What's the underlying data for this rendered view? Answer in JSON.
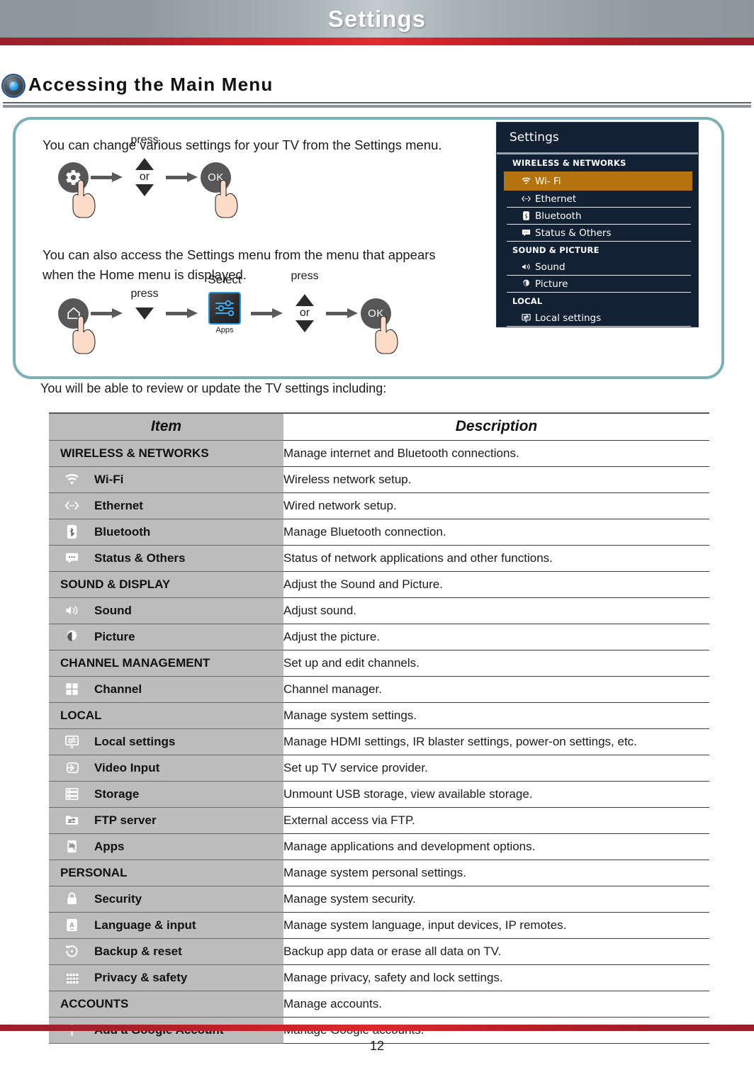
{
  "banner": {
    "title": "Settings"
  },
  "section": {
    "heading": "Accessing the Main Menu",
    "icon": "blue-orb-icon"
  },
  "instructions": {
    "line1": "You can change various settings for your TV from the Settings menu.",
    "line2": "You can also access the Settings menu from the menu that appears when the Home menu is displayed.",
    "flow1": {
      "start_button": "gear-icon",
      "press_label": "press",
      "or_label": "or",
      "ok_label": "OK"
    },
    "flow2": {
      "start_button": "home-icon",
      "press_label_1": "press",
      "select_label": "Select",
      "apps_label": "Apps",
      "press_label_2": "press",
      "or_label": "or",
      "ok_label": "OK"
    }
  },
  "tv_panel": {
    "title": "Settings",
    "highlight_color": "#b5730f",
    "background_color": "#122034",
    "groups": [
      {
        "label": "WIRELESS & NETWORKS",
        "items": [
          {
            "label": "Wi- Fi",
            "icon": "wifi-icon",
            "selected": true
          },
          {
            "label": "Ethernet",
            "icon": "ethernet-icon",
            "selected": false
          },
          {
            "label": "Bluetooth",
            "icon": "bluetooth-icon",
            "selected": false
          },
          {
            "label": "Status & Others",
            "icon": "status-icon",
            "selected": false
          }
        ]
      },
      {
        "label": "SOUND & PICTURE",
        "items": [
          {
            "label": "Sound",
            "icon": "speaker-icon",
            "selected": false
          },
          {
            "label": "Picture",
            "icon": "brightness-icon",
            "selected": false
          }
        ]
      },
      {
        "label": "LOCAL",
        "items": [
          {
            "label": "Local settings",
            "icon": "monitor-settings-icon",
            "selected": false
          }
        ]
      }
    ]
  },
  "sub_caption": "You will be able to review or update the TV settings including:",
  "table": {
    "headers": {
      "item": "Item",
      "description": "Description"
    },
    "rows": [
      {
        "type": "category",
        "item": "WIRELESS & NETWORKS",
        "description": "Manage internet and Bluetooth connections."
      },
      {
        "type": "sub",
        "icon": "wifi-icon",
        "item": "Wi-Fi",
        "description": "Wireless network setup."
      },
      {
        "type": "sub",
        "icon": "ethernet-icon",
        "item": "Ethernet",
        "description": "Wired network setup."
      },
      {
        "type": "sub",
        "icon": "bluetooth-icon",
        "item": "Bluetooth",
        "description": "Manage Bluetooth connection."
      },
      {
        "type": "sub",
        "icon": "status-icon",
        "item": "Status & Others",
        "description": "Status of network applications and other functions."
      },
      {
        "type": "category",
        "item": "SOUND & DISPLAY",
        "description": "Adjust the Sound and Picture."
      },
      {
        "type": "sub",
        "icon": "speaker-icon",
        "item": "Sound",
        "description": "Adjust sound."
      },
      {
        "type": "sub",
        "icon": "brightness-icon",
        "item": "Picture",
        "description": "Adjust the picture."
      },
      {
        "type": "category",
        "item": "CHANNEL MANAGEMENT",
        "description": "Set up and edit channels."
      },
      {
        "type": "sub",
        "icon": "grid-icon",
        "item": "Channel",
        "description": "Channel manager."
      },
      {
        "type": "category",
        "item": "LOCAL",
        "description": "Manage system settings."
      },
      {
        "type": "sub",
        "icon": "monitor-settings-icon",
        "item": "Local settings",
        "description": "Manage HDMI settings, IR blaster settings, power-on settings, etc."
      },
      {
        "type": "sub",
        "icon": "video-input-icon",
        "item": "Video Input",
        "description": "Set up TV service provider."
      },
      {
        "type": "sub",
        "icon": "storage-icon",
        "item": "Storage",
        "description": "Unmount USB storage, view available storage."
      },
      {
        "type": "sub",
        "icon": "ftp-folder-icon",
        "item": "FTP server",
        "description": "External access via FTP."
      },
      {
        "type": "sub",
        "icon": "android-apps-icon",
        "item": "Apps",
        "description": "Manage applications and development options."
      },
      {
        "type": "category",
        "item": "PERSONAL",
        "description": "Manage system personal settings."
      },
      {
        "type": "sub",
        "icon": "lock-icon",
        "item": "Security",
        "description": "Manage system security."
      },
      {
        "type": "sub",
        "icon": "language-icon",
        "item": "Language & input",
        "description": "Manage system language, input devices, IP remotes."
      },
      {
        "type": "sub",
        "icon": "backup-reset-icon",
        "item": "Backup & reset",
        "description": "Backup app data or erase all data on TV."
      },
      {
        "type": "sub",
        "icon": "fence-icon",
        "item": "Privacy & safety",
        "description": "Manage privacy, safety and lock settings."
      },
      {
        "type": "category",
        "item": "ACCOUNTS",
        "description": "Manage accounts."
      },
      {
        "type": "sub",
        "icon": "plus-icon",
        "item": "Add a Google Account",
        "description": "Manage Google accounts."
      }
    ]
  },
  "footer": {
    "page_number": "12"
  }
}
